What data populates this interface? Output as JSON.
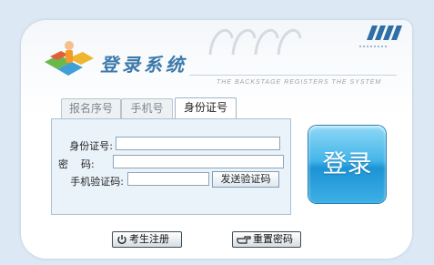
{
  "header": {
    "title": "登录系统",
    "subtitle": "THE BACKSTAGE REGISTERS THE SYSTEM",
    "logo_icon": "users-puzzle-icon"
  },
  "tabs": [
    {
      "label": "报名序号",
      "active": false
    },
    {
      "label": "手机号",
      "active": false
    },
    {
      "label": "身份证号",
      "active": true
    }
  ],
  "form": {
    "id_label": "身份证号:",
    "password_label": "密    码:",
    "sms_label": "手机验证码:",
    "id_value": "",
    "password_value": "",
    "sms_value": "",
    "send_code_label": "发送验证码"
  },
  "login_label": "登录",
  "footer": {
    "register_label": "考生注册",
    "register_icon": "power-icon",
    "reset_label": "重置密码",
    "reset_icon": "hand-pointer-icon"
  },
  "colors": {
    "page_bg": "#dce9f4",
    "accent": "#3c7aab",
    "login_button": "#2aa4e2",
    "form_bg": "#eaf3fa"
  }
}
